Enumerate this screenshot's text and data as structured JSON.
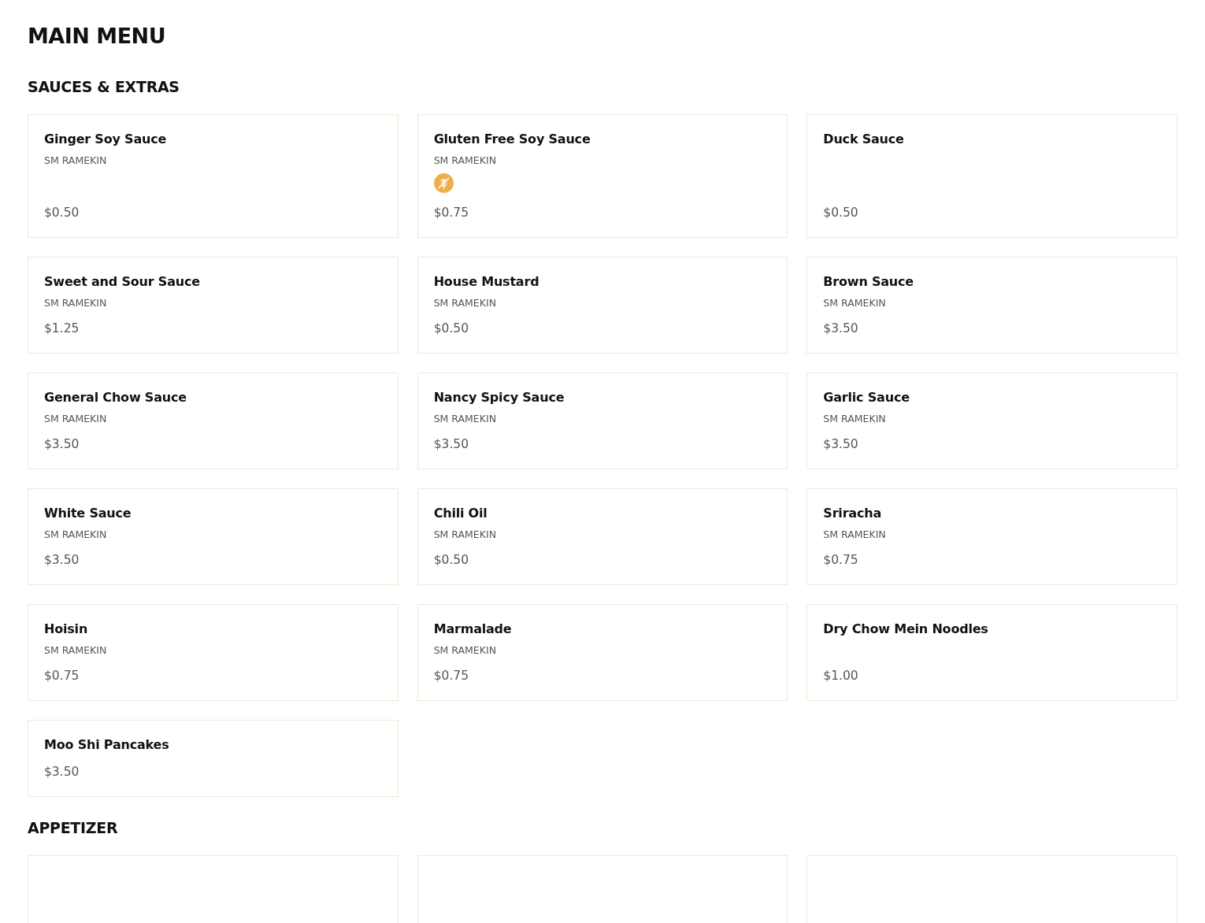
{
  "title": "MAIN MENU",
  "sections": [
    {
      "title": "SAUCES & EXTRAS",
      "items": [
        {
          "kind": "item",
          "name": "Ginger Soy Sauce",
          "portion": "SM RAMEKIN",
          "gluten_free": false,
          "price": "$0.50"
        },
        {
          "kind": "item",
          "name": "Gluten Free Soy Sauce",
          "portion": "SM RAMEKIN",
          "gluten_free": true,
          "price": "$0.75"
        },
        {
          "kind": "item",
          "name": "Duck Sauce",
          "gluten_free": false,
          "price": "$0.50"
        },
        {
          "kind": "item",
          "name": "Sweet and Sour Sauce",
          "portion": "SM RAMEKIN",
          "gluten_free": false,
          "price": "$1.25"
        },
        {
          "kind": "item",
          "name": "House Mustard",
          "portion": "SM RAMEKIN",
          "gluten_free": false,
          "price": "$0.50"
        },
        {
          "kind": "item",
          "name": "Brown Sauce",
          "portion": "SM RAMEKIN",
          "gluten_free": false,
          "price": "$3.50"
        },
        {
          "kind": "item",
          "name": "General Chow Sauce",
          "portion": "SM RAMEKIN",
          "gluten_free": false,
          "price": "$3.50"
        },
        {
          "kind": "item",
          "name": "Nancy Spicy Sauce",
          "portion": "SM RAMEKIN",
          "gluten_free": false,
          "price": "$3.50"
        },
        {
          "kind": "item",
          "name": "Garlic Sauce",
          "portion": "SM RAMEKIN",
          "gluten_free": false,
          "price": "$3.50"
        },
        {
          "kind": "item",
          "name": "White Sauce",
          "portion": "SM RAMEKIN",
          "gluten_free": false,
          "price": "$3.50"
        },
        {
          "kind": "item",
          "name": "Chili Oil",
          "portion": "SM RAMEKIN",
          "gluten_free": false,
          "price": "$0.50"
        },
        {
          "kind": "item",
          "name": "Sriracha",
          "portion": "SM RAMEKIN",
          "gluten_free": false,
          "price": "$0.75"
        },
        {
          "kind": "item",
          "name": "Hoisin",
          "portion": "SM RAMEKIN",
          "gluten_free": false,
          "price": "$0.75"
        },
        {
          "kind": "item",
          "name": "Marmalade",
          "portion": "SM RAMEKIN",
          "gluten_free": false,
          "price": "$0.75"
        },
        {
          "kind": "item",
          "name": "Dry Chow Mein Noodles",
          "gluten_free": false,
          "price": "$1.00"
        },
        {
          "kind": "item",
          "name": "Moo Shi Pancakes",
          "gluten_free": false,
          "price": "$3.50"
        }
      ]
    },
    {
      "title": "APPETIZER",
      "items": [
        {
          "kind": "cut_off"
        },
        {
          "kind": "cut_off"
        },
        {
          "kind": "cut_off"
        }
      ]
    }
  ]
}
